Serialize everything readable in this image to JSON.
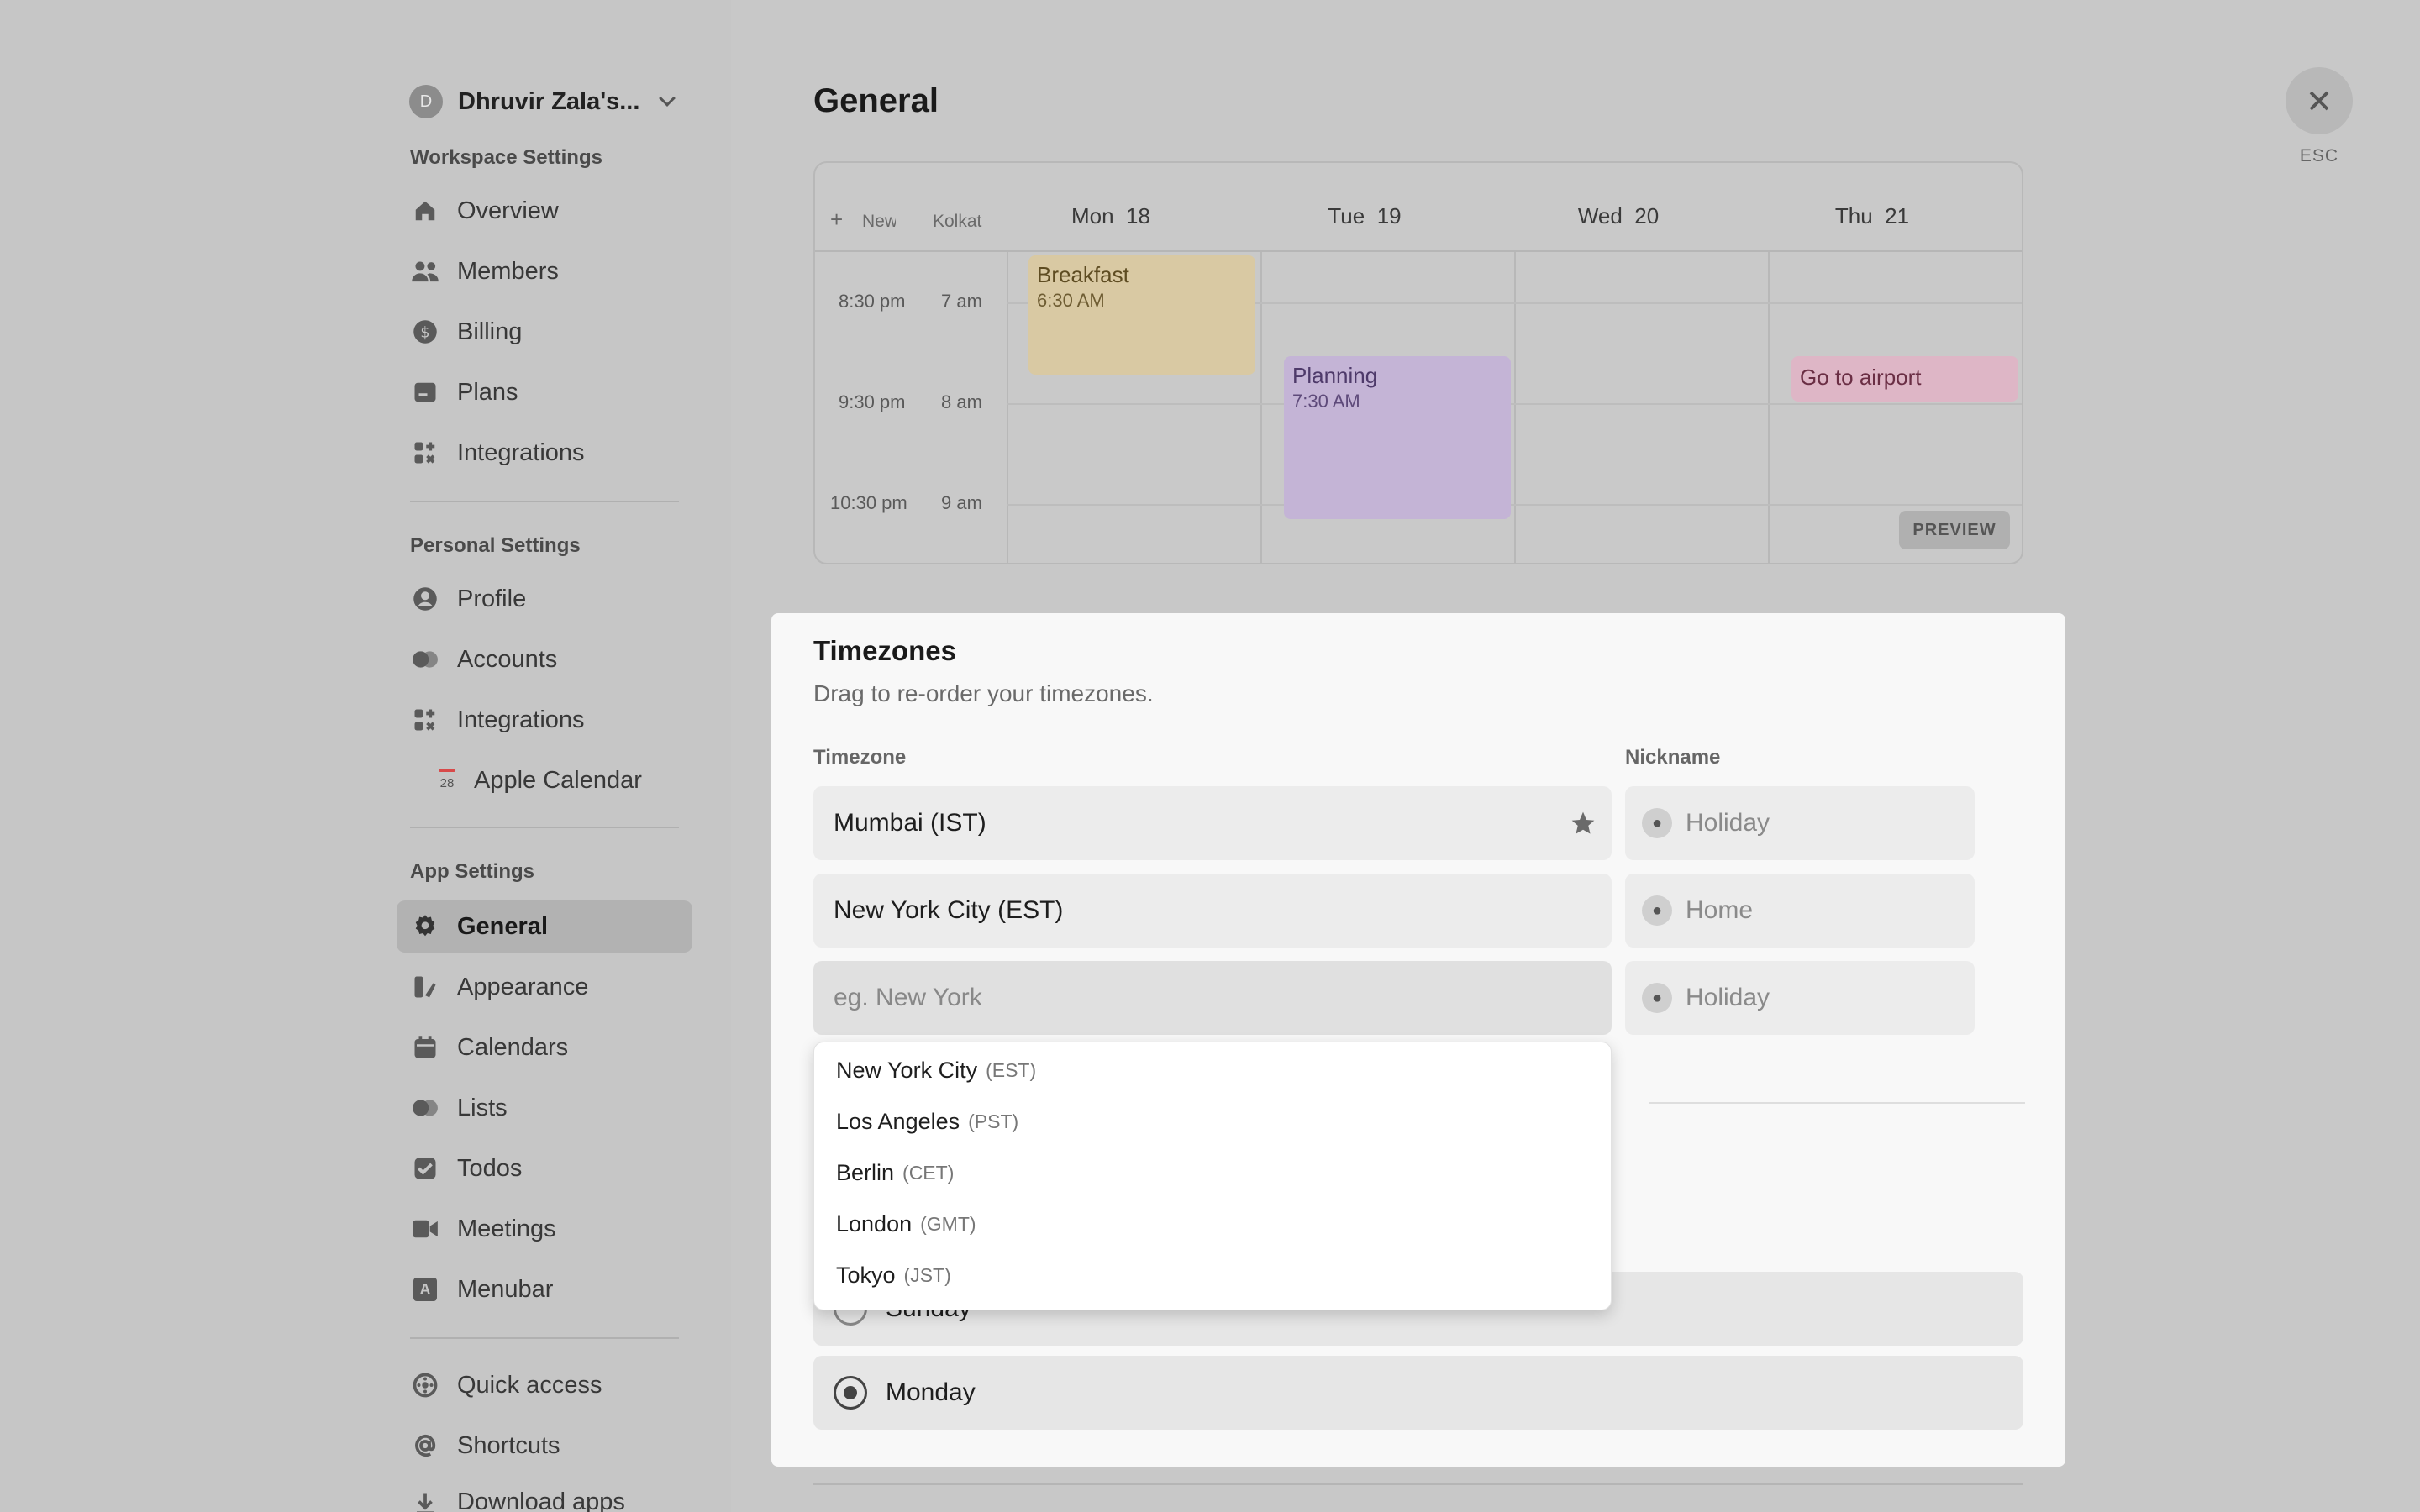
{
  "workspace": {
    "avatar_letter": "D",
    "name": "Dhruvir Zala's..."
  },
  "sidebar": {
    "workspace_heading": "Workspace Settings",
    "workspace_items": [
      {
        "label": "Overview",
        "icon": "home-icon"
      },
      {
        "label": "Members",
        "icon": "members-icon"
      },
      {
        "label": "Billing",
        "icon": "dollar-icon"
      },
      {
        "label": "Plans",
        "icon": "plans-icon"
      },
      {
        "label": "Integrations",
        "icon": "integrations-icon"
      }
    ],
    "personal_heading": "Personal Settings",
    "personal_items": [
      {
        "label": "Profile",
        "icon": "profile-icon"
      },
      {
        "label": "Accounts",
        "icon": "accounts-icon"
      },
      {
        "label": "Integrations",
        "icon": "integrations-icon"
      },
      {
        "label": "Apple Calendar",
        "icon": "calendar-date-icon",
        "date": "28"
      }
    ],
    "app_heading": "App Settings",
    "app_items": [
      {
        "label": "General",
        "icon": "gear-icon",
        "active": true
      },
      {
        "label": "Appearance",
        "icon": "appearance-icon"
      },
      {
        "label": "Calendars",
        "icon": "calendar-icon"
      },
      {
        "label": "Lists",
        "icon": "lists-icon"
      },
      {
        "label": "Todos",
        "icon": "check-icon"
      },
      {
        "label": "Meetings",
        "icon": "video-icon"
      },
      {
        "label": "Menubar",
        "icon": "menubar-icon",
        "glyph": "A"
      }
    ],
    "other_items": [
      {
        "label": "Quick access",
        "icon": "quick-access-icon"
      },
      {
        "label": "Shortcuts",
        "icon": "at-icon"
      },
      {
        "label": "Download apps",
        "icon": "download-icon"
      }
    ]
  },
  "header": {
    "title": "General",
    "esc_label": "ESC"
  },
  "calendar_preview": {
    "add_symbol": "+",
    "tz_headers": [
      "New Y",
      "Kolkat"
    ],
    "days": [
      {
        "name": "Mon",
        "num": "18"
      },
      {
        "name": "Tue",
        "num": "19"
      },
      {
        "name": "Wed",
        "num": "20"
      },
      {
        "name": "Thu",
        "num": "21"
      }
    ],
    "rows": [
      {
        "tz1": "8:30 pm",
        "tz2": "7 am"
      },
      {
        "tz1": "9:30 pm",
        "tz2": "8 am"
      },
      {
        "tz1": "10:30 pm",
        "tz2": "9 am"
      }
    ],
    "events": [
      {
        "title": "Breakfast",
        "time": "6:30 AM",
        "color": "#d9c9a3"
      },
      {
        "title": "Planning",
        "time": "7:30 AM",
        "color": "#c4b4d6"
      },
      {
        "title": "Go to airport",
        "time": "",
        "color": "#deb6c6"
      }
    ],
    "preview_badge": "PREVIEW"
  },
  "timezones": {
    "title": "Timezones",
    "subtitle": "Drag to re-order your timezones.",
    "timezone_col": "Timezone",
    "nickname_col": "Nickname",
    "rows": [
      {
        "timezone": "Mumbai (IST)",
        "starred": true,
        "nickname_placeholder": "Holiday"
      },
      {
        "timezone": "New York City (EST)",
        "starred": false,
        "nickname_placeholder": "Home"
      },
      {
        "timezone": "",
        "placeholder": "eg. New York",
        "starred": false,
        "nickname_placeholder": "Holiday"
      }
    ],
    "dropdown_options": [
      {
        "city": "New York City",
        "abbr": "(EST)"
      },
      {
        "city": "Los Angeles",
        "abbr": "(PST)"
      },
      {
        "city": "Berlin",
        "abbr": "(CET)"
      },
      {
        "city": "London",
        "abbr": "(GMT)"
      },
      {
        "city": "Tokyo",
        "abbr": "(JST)"
      }
    ]
  },
  "week_start": {
    "options": [
      {
        "label": "Sunday",
        "selected": false
      },
      {
        "label": "Monday",
        "selected": true
      }
    ]
  },
  "colors": {
    "accent": "#444444",
    "panel": "#f8f8f8",
    "overlay": "#c8c8c8"
  }
}
